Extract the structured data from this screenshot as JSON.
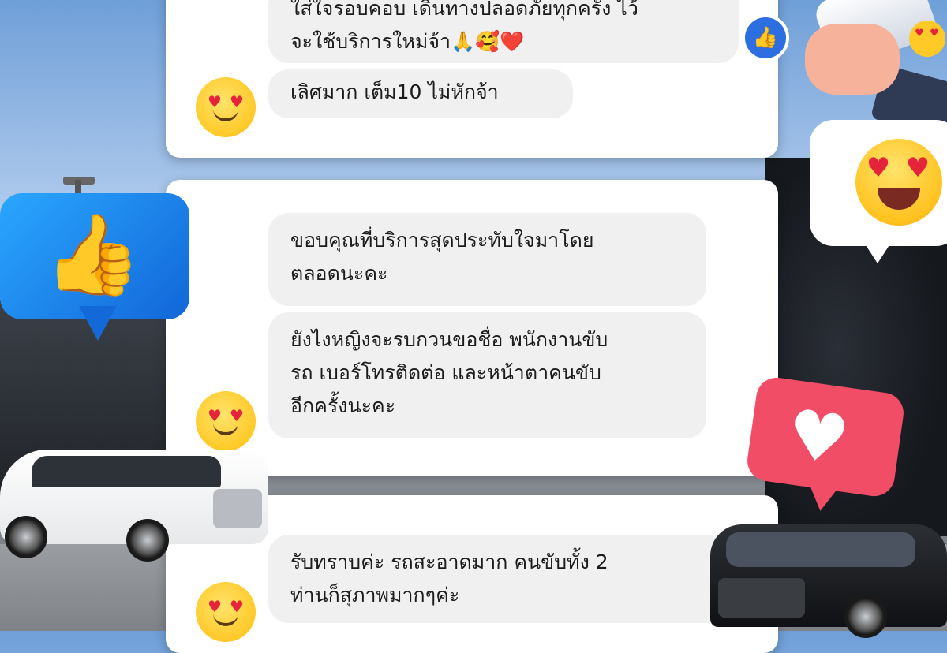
{
  "messages": {
    "card1": {
      "bubble1_line1": "ใส่ใจรอบคอบ เดินทางปลอดภัยทุกครั้ง ไว้",
      "bubble1_line2": "จะใช้บริการใหม่จ้า🙏🥰❤️",
      "bubble2": "เลิศมาก เต็ม10 ไม่หักจ้า"
    },
    "card2": {
      "bubble1_line1": "ขอบคุณที่บริการสุดประทับใจมาโดย",
      "bubble1_line2": "ตลอดนะคะ",
      "bubble2_line1": "ยังไงหญิงจะรบกวนขอชื่อ พนักงานขับ",
      "bubble2_line2": "รถ เบอร์โทรติดต่อ และหน้าตาคนขับ",
      "bubble2_line3": "อีกครั้งนะคะ"
    },
    "card3": {
      "bubble1_line1": "รับทราบค่ะ รถสะอาดมาก คนขับทั้ง 2",
      "bubble1_line2": "ท่านก็สุภาพมากๆค่ะ"
    }
  },
  "icons": {
    "reaction_like": "like-icon",
    "reaction_heart": "heart-icon",
    "reaction_heart_eyes": "heart-eyes-emoji-icon",
    "avatar": "smiling-heart-eyes-emoji-icon",
    "megaphone": "megaphone-icon"
  },
  "colors": {
    "bubble_bg": "#f0f0f0",
    "like_blue": "#1877f2",
    "heart_pink": "#f24d67",
    "text": "#1c1c1c"
  }
}
